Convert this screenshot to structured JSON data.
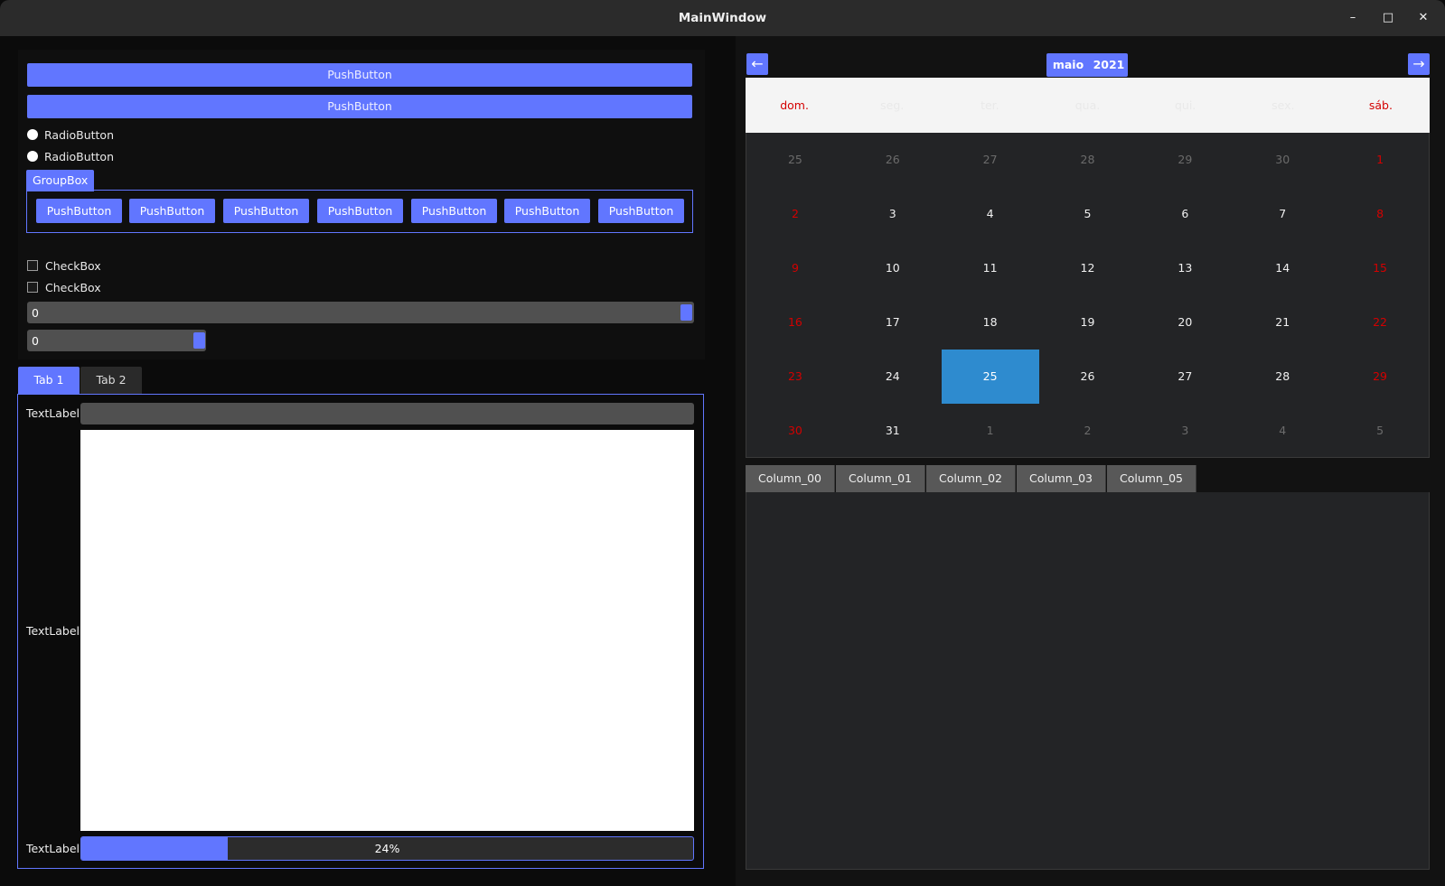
{
  "window": {
    "title": "MainWindow",
    "controls": [
      "minimize-icon",
      "maximize-icon",
      "close-icon"
    ]
  },
  "buttons": {
    "push_top": "PushButton",
    "push_second": "PushButton"
  },
  "radios": [
    "RadioButton",
    "RadioButton"
  ],
  "groupbox": {
    "title": "GroupBox",
    "buttons": [
      "PushButton",
      "PushButton",
      "PushButton",
      "PushButton",
      "PushButton",
      "PushButton",
      "PushButton"
    ]
  },
  "checkboxes": [
    "CheckBox",
    "CheckBox"
  ],
  "spinboxes": [
    "0",
    "0"
  ],
  "tabs": [
    "Tab 1",
    "Tab 2"
  ],
  "form": {
    "label_line": "TextLabel",
    "label_text": "TextLabel",
    "label_progress": "TextLabel",
    "progress": {
      "value": 0.24,
      "text": "24%"
    }
  },
  "calendar": {
    "month": "maio",
    "year": "2021",
    "weekdays": [
      "dom.",
      "seg.",
      "ter.",
      "qua.",
      "qui.",
      "sex.",
      "sáb."
    ],
    "days": [
      [
        "25",
        "26",
        "27",
        "28",
        "29",
        "30",
        "1"
      ],
      [
        "2",
        "3",
        "4",
        "5",
        "6",
        "7",
        "8"
      ],
      [
        "9",
        "10",
        "11",
        "12",
        "13",
        "14",
        "15"
      ],
      [
        "16",
        "17",
        "18",
        "19",
        "20",
        "21",
        "22"
      ],
      [
        "23",
        "24",
        "25",
        "26",
        "27",
        "28",
        "29"
      ],
      [
        "30",
        "31",
        "1",
        "2",
        "3",
        "4",
        "5"
      ]
    ],
    "selected": "25"
  },
  "table": {
    "columns": [
      "Column_00",
      "Column_01",
      "Column_02",
      "Column_03",
      "Column_05"
    ]
  },
  "colors": {
    "accent": "#6176ff",
    "selected_day": "#2e8bcf",
    "weekend": "#d40000"
  }
}
